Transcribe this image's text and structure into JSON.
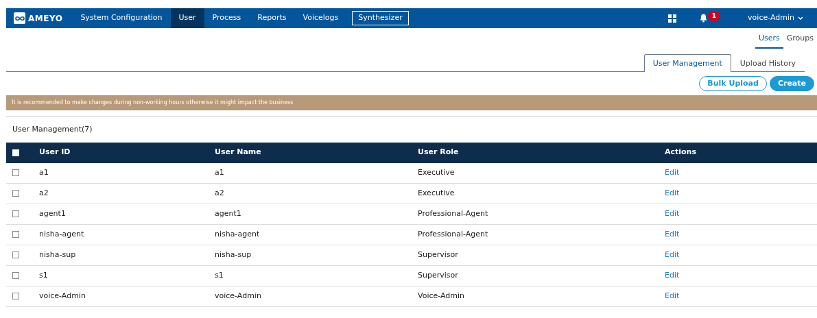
{
  "navbar": {
    "brand": "AMEYO",
    "items": [
      {
        "label": "System Configuration",
        "selected": false,
        "kind": "link"
      },
      {
        "label": "User",
        "selected": true,
        "kind": "link"
      },
      {
        "label": "Process",
        "selected": false,
        "kind": "link"
      },
      {
        "label": "Reports",
        "selected": false,
        "kind": "link"
      },
      {
        "label": "Voicelogs",
        "selected": false,
        "kind": "link"
      },
      {
        "label": "Synthesizer",
        "selected": false,
        "kind": "outlined"
      }
    ],
    "notification_count": "1",
    "user": "voice-Admin"
  },
  "subnav": [
    {
      "label": "Users",
      "selected": true
    },
    {
      "label": "Groups",
      "selected": false
    }
  ],
  "tabs": [
    {
      "label": "User Management",
      "selected": true
    },
    {
      "label": "Upload History",
      "selected": false
    }
  ],
  "buttons": [
    {
      "label": "Bulk Upload",
      "kind": "outline"
    },
    {
      "label": "Create",
      "kind": "solid"
    }
  ],
  "warning": "It is recommended to make changes during non-working hours otherwise it might impact the business",
  "section_title": "User Management(7)",
  "table": {
    "select_all_checked": false,
    "columns": [
      "User ID",
      "User Name",
      "User Role",
      "Actions"
    ],
    "rows": [
      {
        "checked": false,
        "cells": [
          "a1",
          "a1",
          "Executive"
        ],
        "action": "Edit"
      },
      {
        "checked": false,
        "cells": [
          "a2",
          "a2",
          "Executive"
        ],
        "action": "Edit"
      },
      {
        "checked": false,
        "cells": [
          "agent1",
          "agent1",
          "Professional-Agent"
        ],
        "action": "Edit"
      },
      {
        "checked": false,
        "cells": [
          "nisha-agent",
          "nisha-agent",
          "Professional-Agent"
        ],
        "action": "Edit"
      },
      {
        "checked": false,
        "cells": [
          "nisha-sup",
          "nisha-sup",
          "Supervisor"
        ],
        "action": "Edit"
      },
      {
        "checked": false,
        "cells": [
          "s1",
          "s1",
          "Supervisor"
        ],
        "action": "Edit"
      },
      {
        "checked": false,
        "cells": [
          "voice-Admin",
          "voice-Admin",
          "Voice-Admin"
        ],
        "action": "Edit"
      }
    ]
  }
}
